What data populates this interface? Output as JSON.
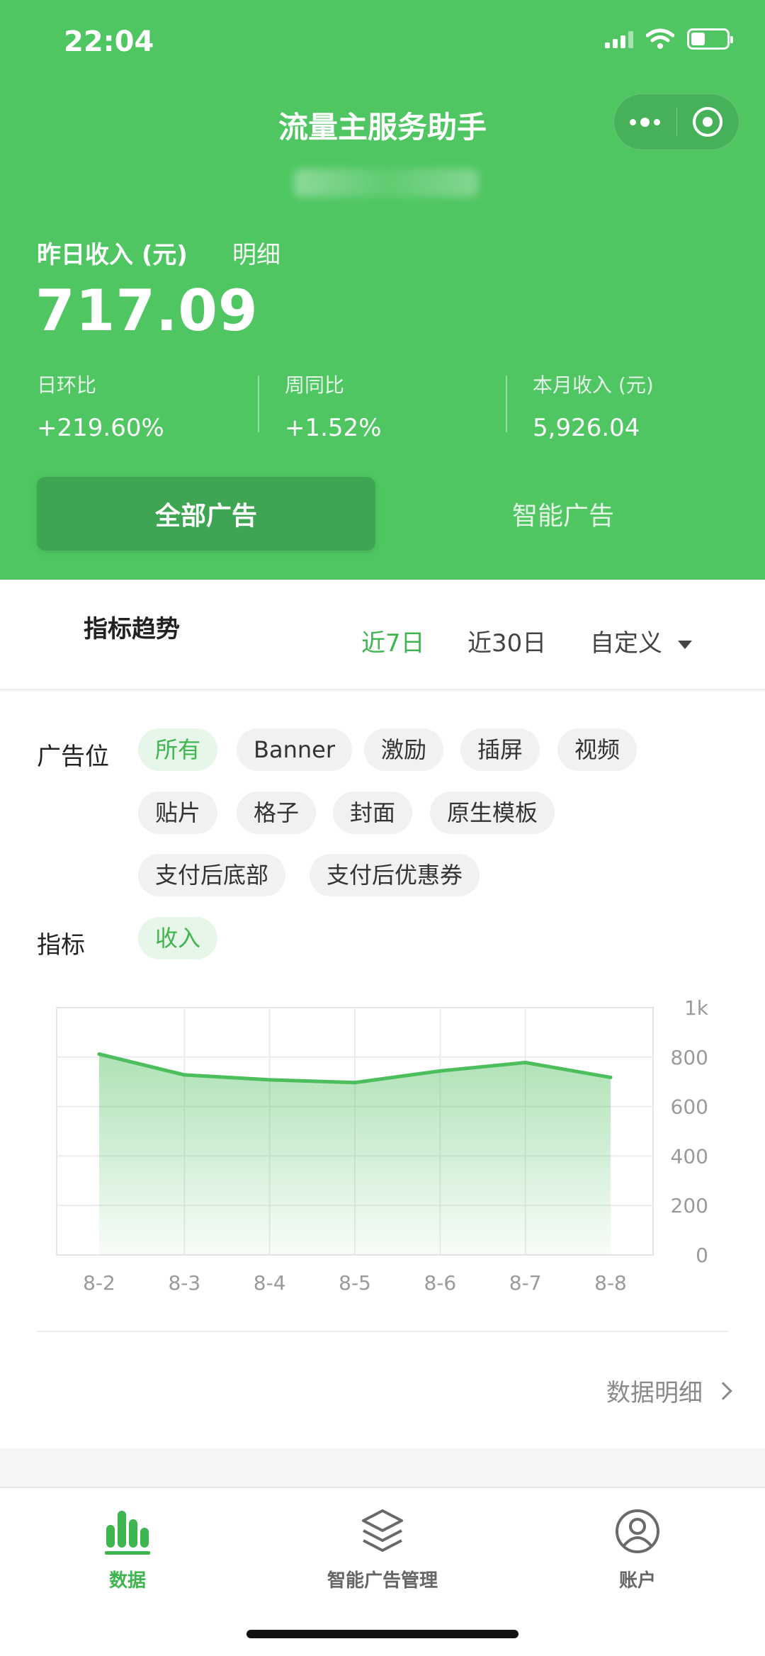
{
  "status": {
    "time": "22:04"
  },
  "header": {
    "title": "流量主服务助手",
    "income_label": "昨日收入 (元)",
    "detail_link": "明细",
    "income_value": "717.09",
    "stats": [
      {
        "label": "日环比",
        "value": "+219.60%"
      },
      {
        "label": "周同比",
        "value": "+1.52%"
      },
      {
        "label": "本月收入 (元)",
        "value": "5,926.04"
      }
    ],
    "segments": [
      "全部广告",
      "智能广告"
    ],
    "active_segment": "全部广告"
  },
  "trend": {
    "title": "指标趋势",
    "ranges": [
      "近7日",
      "近30日",
      "自定义"
    ],
    "active_range": "近7日"
  },
  "filters": {
    "ad_slot_label": "广告位",
    "ad_slots": [
      "所有",
      "Banner",
      "激励",
      "插屏",
      "视频",
      "贴片",
      "格子",
      "封面",
      "原生模板",
      "支付后底部",
      "支付后优惠券"
    ],
    "active_slot": "所有",
    "metric_label": "指标",
    "metrics": [
      "收入"
    ],
    "active_metric": "收入"
  },
  "chart_data": {
    "type": "area",
    "categories": [
      "8-2",
      "8-3",
      "8-4",
      "8-5",
      "8-6",
      "8-7",
      "8-8"
    ],
    "series": [
      {
        "values": [
          812,
          728,
          708,
          697,
          744,
          778,
          718
        ]
      }
    ],
    "y_ticks": [
      "0",
      "200",
      "400",
      "600",
      "800",
      "1k"
    ],
    "ylim": [
      0,
      1000
    ],
    "grid": true,
    "y_axis_side": "right",
    "color": "#4cbe5c"
  },
  "footer_link": "数据明细",
  "tabbar": {
    "items": [
      {
        "label": "数据",
        "icon": "bar-chart-icon"
      },
      {
        "label": "智能广告管理",
        "icon": "layers-icon"
      },
      {
        "label": "账户",
        "icon": "user-circle-icon"
      }
    ],
    "active": "数据"
  },
  "colors": {
    "primary": "#4fc662",
    "accent": "#3fb54f",
    "segment_active": "#3ea653"
  }
}
